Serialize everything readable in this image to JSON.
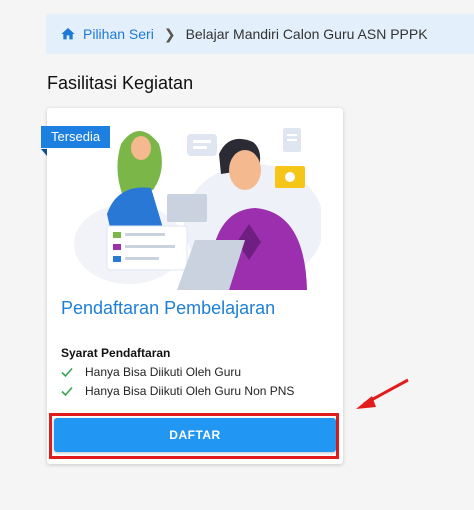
{
  "breadcrumb": {
    "home_label": "Pilihan Seri",
    "current_label": "Belajar Mandiri Calon Guru ASN PPPK"
  },
  "section": {
    "title": "Fasilitasi Kegiatan"
  },
  "card": {
    "badge": "Tersedia",
    "title": "Pendaftaran Pembelajaran",
    "requirements_title": "Syarat Pendaftaran",
    "requirements": [
      "Hanya Bisa Diikuti Oleh Guru",
      "Hanya Bisa Diikuti Oleh Guru Non PNS"
    ],
    "button_label": "DAFTAR"
  },
  "icons": {
    "home": "home-icon",
    "separator": "chevron-right-icon",
    "check": "check-icon"
  },
  "colors": {
    "accent": "#1e7fd6",
    "button": "#2196f3",
    "highlight": "#e21b1b",
    "check": "#3aa356"
  }
}
